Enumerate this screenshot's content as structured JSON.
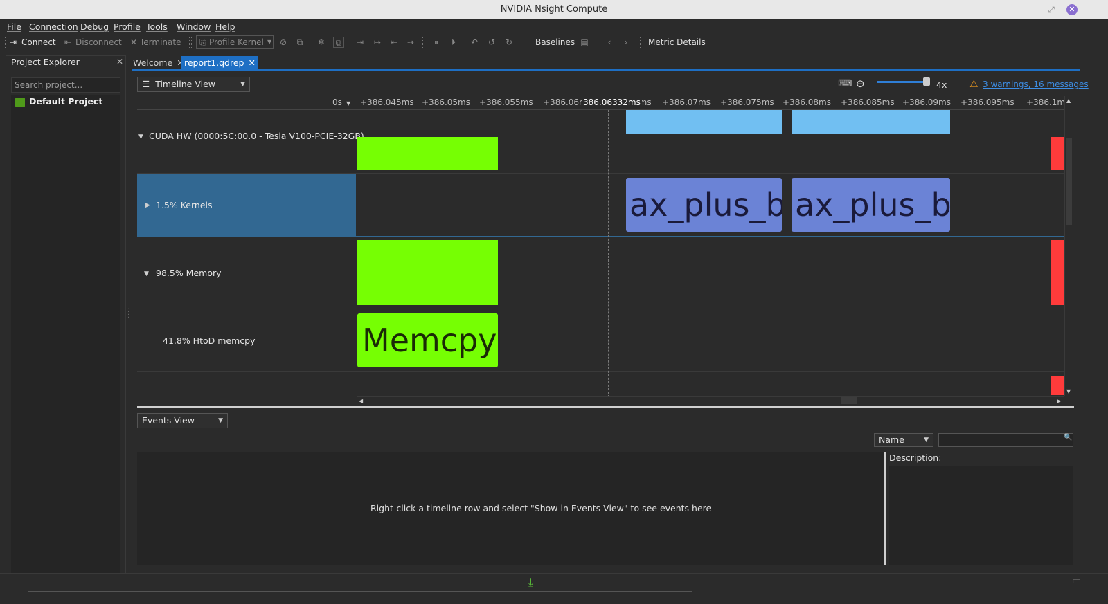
{
  "window": {
    "title": "NVIDIA Nsight Compute"
  },
  "menu": [
    "File",
    "Connection",
    "Debug",
    "Profile",
    "Tools",
    "Window",
    "Help"
  ],
  "toolbar": {
    "connect": "Connect",
    "disconnect": "Disconnect",
    "terminate": "Terminate",
    "profile_kernel": "Profile Kernel",
    "baselines": "Baselines",
    "metric_details": "Metric Details"
  },
  "project_explorer": {
    "title": "Project Explorer",
    "search_placeholder": "Search project...",
    "project": "Default Project"
  },
  "tabs": [
    {
      "label": "Welcome",
      "active": false
    },
    {
      "label": "report1.qdrep",
      "active": true
    }
  ],
  "timeline": {
    "view_select": "Timeline View",
    "zoom": "4x",
    "warnings": "3 warnings, 16 messages",
    "ruler_start": "0s",
    "cursor_time": "386.06332ms",
    "ticks": [
      "+386.045ms",
      "+386.05ms",
      "+386.055ms",
      "+386.06m",
      "5ms",
      "+386.07ms",
      "+386.075ms",
      "+386.08ms",
      "+386.085ms",
      "+386.09ms",
      "+386.095ms",
      "+386.1ms"
    ],
    "rows": {
      "cuda_hw": "CUDA HW (0000:5C:00.0 - Tesla V100-PCIE-32GB)",
      "kernels": "1.5% Kernels",
      "memory": "98.5% Memory",
      "htod": "41.8% HtoD memcpy"
    },
    "kernel_labels": [
      "ax_plus_b…",
      "ax_plus_b…"
    ],
    "memcpy_label": "Memcpy…",
    "colors": {
      "memory": "#76ff03",
      "kernel_summary": "#71bff2",
      "kernel": "#6b83d6",
      "other": "#ff3b3b",
      "selection": "#326892"
    }
  },
  "events": {
    "view_select": "Events View",
    "filter_select": "Name",
    "empty_message": "Right-click a timeline row and select \"Show in Events View\" to see events here",
    "description_label": "Description:"
  }
}
